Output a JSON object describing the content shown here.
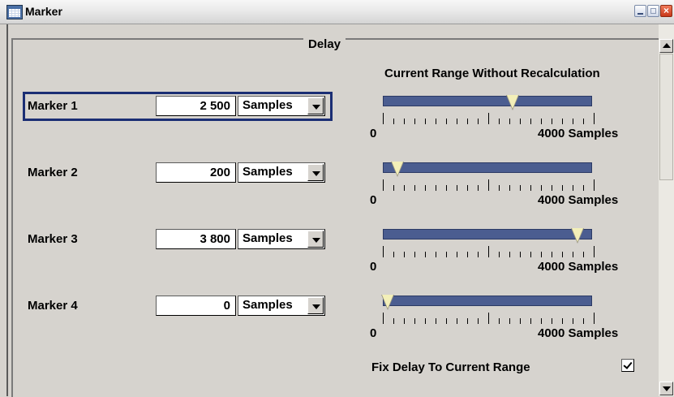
{
  "window": {
    "title": "Marker",
    "icon": "table-grid-icon"
  },
  "group": {
    "title": "Delay",
    "range_title": "Current Range Without Recalculation"
  },
  "markers": [
    {
      "label": "Marker 1",
      "value": "2 500",
      "unit": "Samples",
      "position_fraction": 0.625,
      "range_min": "0",
      "range_max": "4000 Samples"
    },
    {
      "label": "Marker 2",
      "value": "200",
      "unit": "Samples",
      "position_fraction": 0.05,
      "range_min": "0",
      "range_max": "4000 Samples"
    },
    {
      "label": "Marker 3",
      "value": "3 800",
      "unit": "Samples",
      "position_fraction": 0.95,
      "range_min": "0",
      "range_max": "4000 Samples"
    },
    {
      "label": "Marker 4",
      "value": "0",
      "unit": "Samples",
      "position_fraction": 0.0,
      "range_min": "0",
      "range_max": "4000 Samples"
    }
  ],
  "fix_delay": {
    "label": "Fix Delay To Current Range",
    "checked": true
  },
  "colors": {
    "bar": "#4b5d90",
    "marker": "#f3efb8",
    "focus_frame": "#1b2e74"
  }
}
